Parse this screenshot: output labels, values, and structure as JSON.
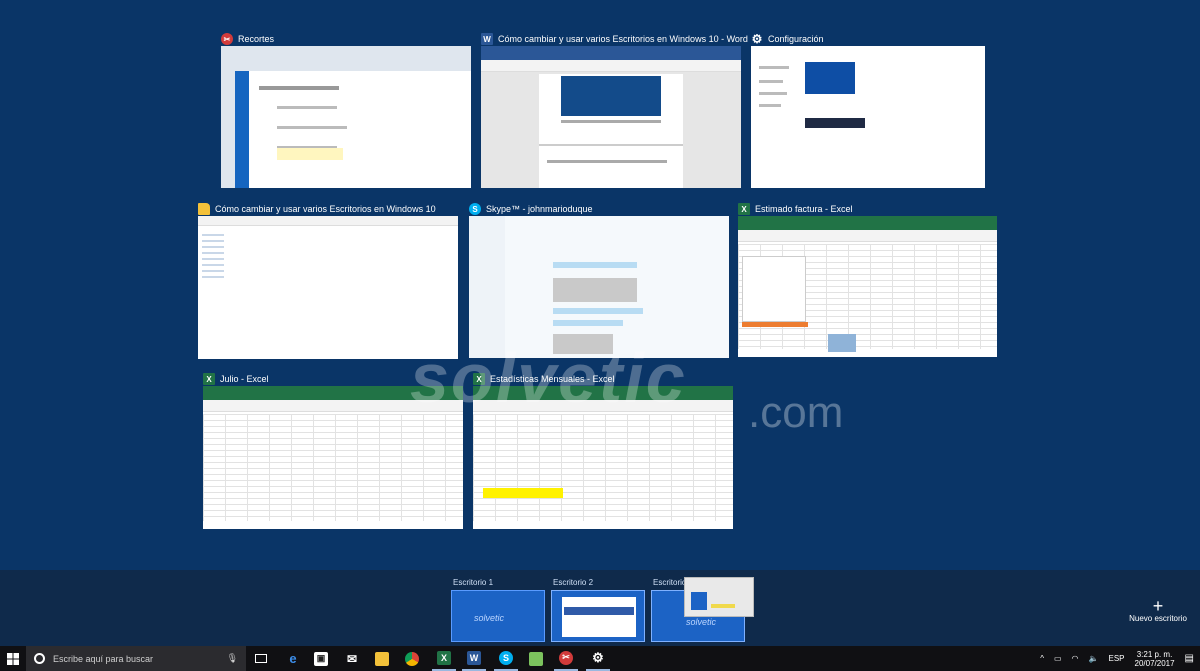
{
  "windows": [
    {
      "title": "Recortes",
      "icon": "snipping-tool-icon"
    },
    {
      "title": "Cómo cambiar y usar varios Escritorios en Windows 10 - Word",
      "icon": "word-icon"
    },
    {
      "title": "Configuración",
      "icon": "gear-icon"
    },
    {
      "title": "Cómo cambiar y usar varios Escritorios en Windows 10",
      "icon": "folder-icon"
    },
    {
      "title": "Skype™ - johnmarioduque",
      "icon": "skype-icon"
    },
    {
      "title": "Estimado factura - Excel",
      "icon": "excel-icon"
    },
    {
      "title": "Julio - Excel",
      "icon": "excel-icon"
    },
    {
      "title": "Estadísticas Mensuales - Excel",
      "icon": "excel-icon"
    }
  ],
  "desktops": [
    {
      "label": "Escritorio 1"
    },
    {
      "label": "Escritorio 2"
    },
    {
      "label": "Escritorio"
    }
  ],
  "new_desktop": {
    "plus": "+",
    "label": "Nuevo escritorio"
  },
  "watermark": {
    "brand": "solvetic",
    "suffix": ".com"
  },
  "taskbar": {
    "search_placeholder": "Escribe aquí para buscar",
    "lang": "ESP",
    "time": "3:21 p. m.",
    "date": "20/07/2017"
  },
  "colors": {
    "accent": "#1c63c5",
    "excel": "#217346",
    "word": "#2b5797",
    "background": "#0a3567"
  }
}
